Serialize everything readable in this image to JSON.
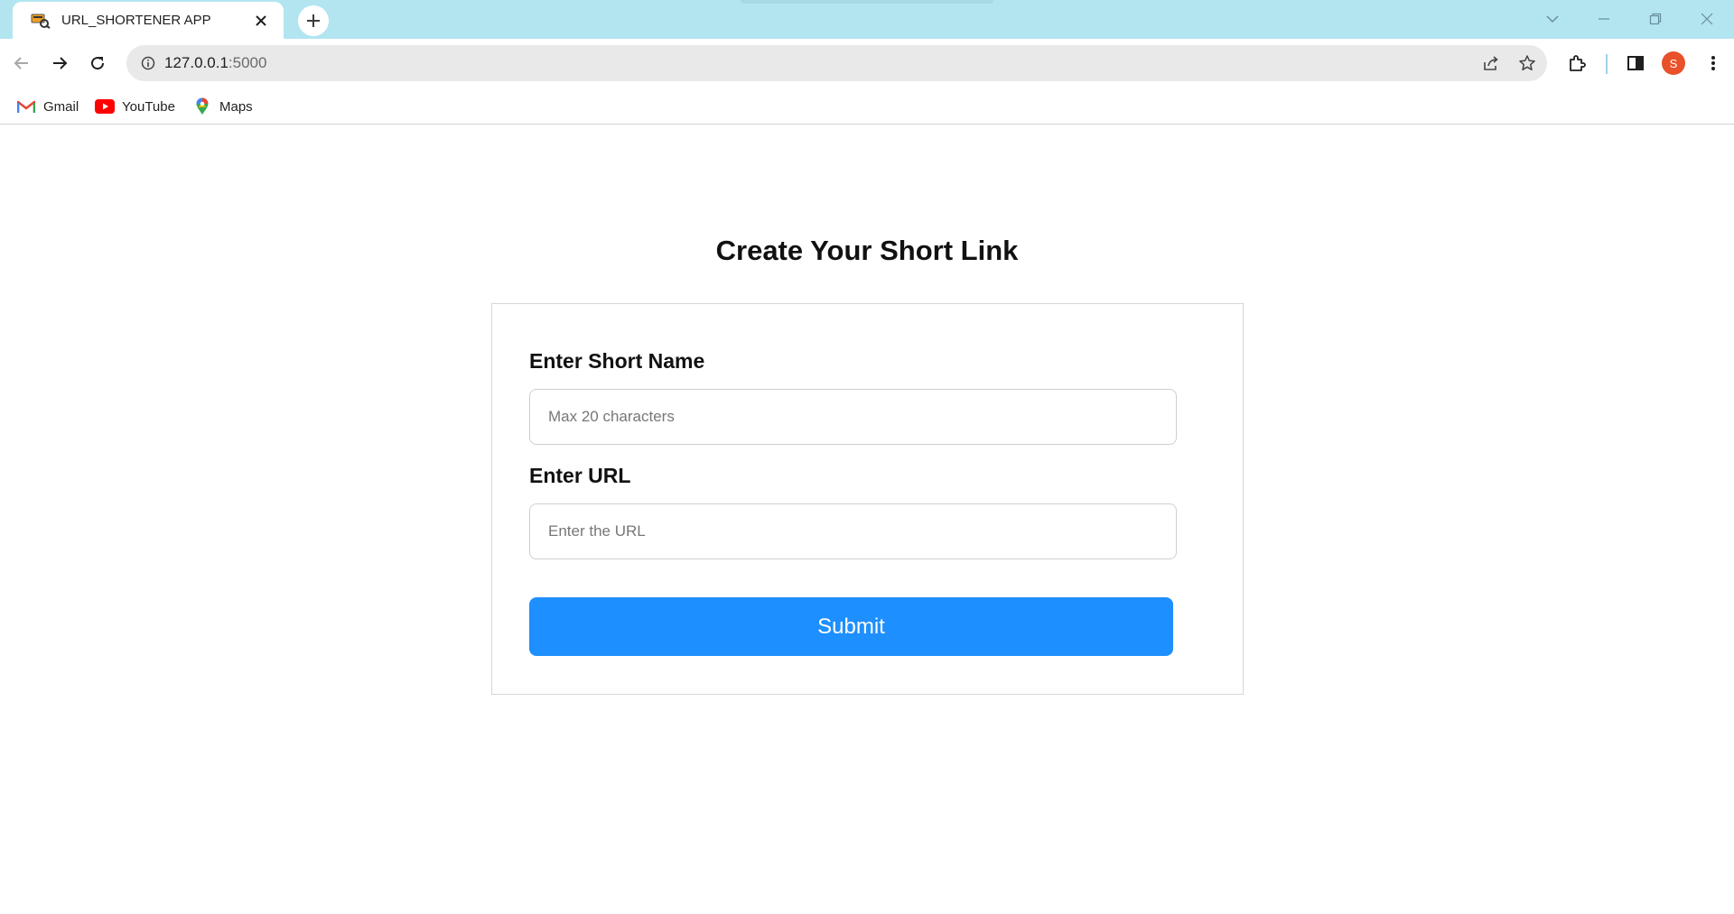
{
  "browser": {
    "tab": {
      "title": "URL_SHORTENER APP"
    },
    "address": {
      "host": "127.0.0.1",
      "port": ":5000"
    },
    "profile_initial": "S",
    "bookmarks": [
      {
        "label": "Gmail",
        "icon": "gmail-icon"
      },
      {
        "label": "YouTube",
        "icon": "youtube-icon"
      },
      {
        "label": "Maps",
        "icon": "maps-icon"
      }
    ],
    "colors": {
      "tabstrip": "#b3e5f1",
      "avatar": "#e8512a"
    }
  },
  "page": {
    "title": "Create Your Short Link",
    "form": {
      "short_name_label": "Enter Short Name",
      "short_name_placeholder": "Max 20 characters",
      "short_name_value": "",
      "url_label": "Enter URL",
      "url_placeholder": "Enter the URL",
      "url_value": "",
      "submit_label": "Submit"
    },
    "colors": {
      "submit_button": "#1e8ffe"
    }
  }
}
